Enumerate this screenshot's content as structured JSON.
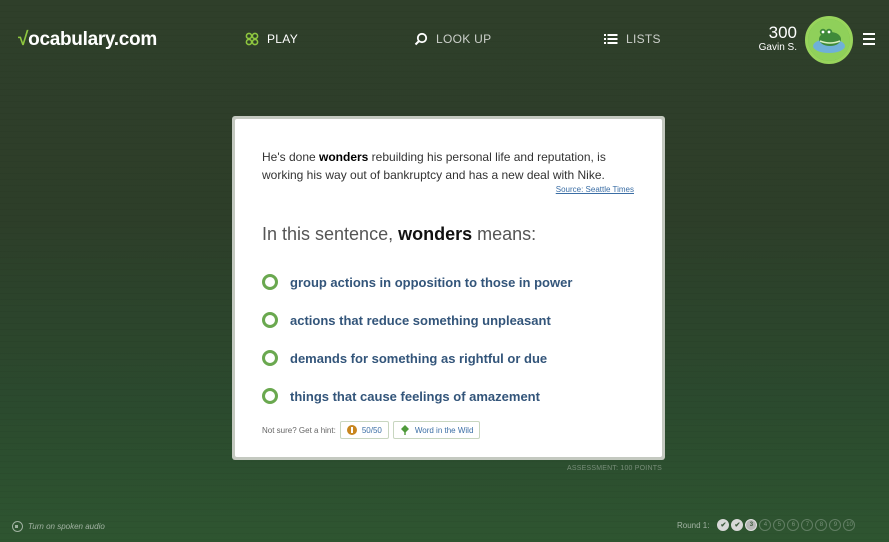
{
  "header": {
    "logo_check": "√",
    "logo_text": "ocabulary.com",
    "nav": {
      "play": "PLAY",
      "lookup": "LOOK UP",
      "lists": "LISTS"
    },
    "score": "300",
    "user_name": "Gavin S."
  },
  "card": {
    "sentence_pre": "He's done ",
    "sentence_word": "wonders",
    "sentence_post": " rebuilding his personal life and reputation, is working his way out of bankruptcy and has a new deal with Nike.",
    "source": "Source: Seattle Times",
    "question_pre": "In this sentence, ",
    "question_word": "wonders",
    "question_post": " means:",
    "choices": [
      "group actions in opposition to those in power",
      "actions that reduce something unpleasant",
      "demands for something as rightful or due",
      "things that cause feelings of amazement"
    ],
    "hint_label": "Not sure? Get a hint:",
    "hint_5050": "50/50",
    "hint_wild": "Word in the Wild"
  },
  "assessment": "ASSESSMENT: 100 POINTS",
  "footer": {
    "audio": "Turn on spoken audio",
    "round_label": "Round 1:",
    "dots": [
      "✔",
      "✔",
      "3",
      "4",
      "5",
      "6",
      "7",
      "8",
      "9",
      "10"
    ]
  },
  "colors": {
    "accent_green": "#6aa84f",
    "link_blue": "#33557a"
  }
}
